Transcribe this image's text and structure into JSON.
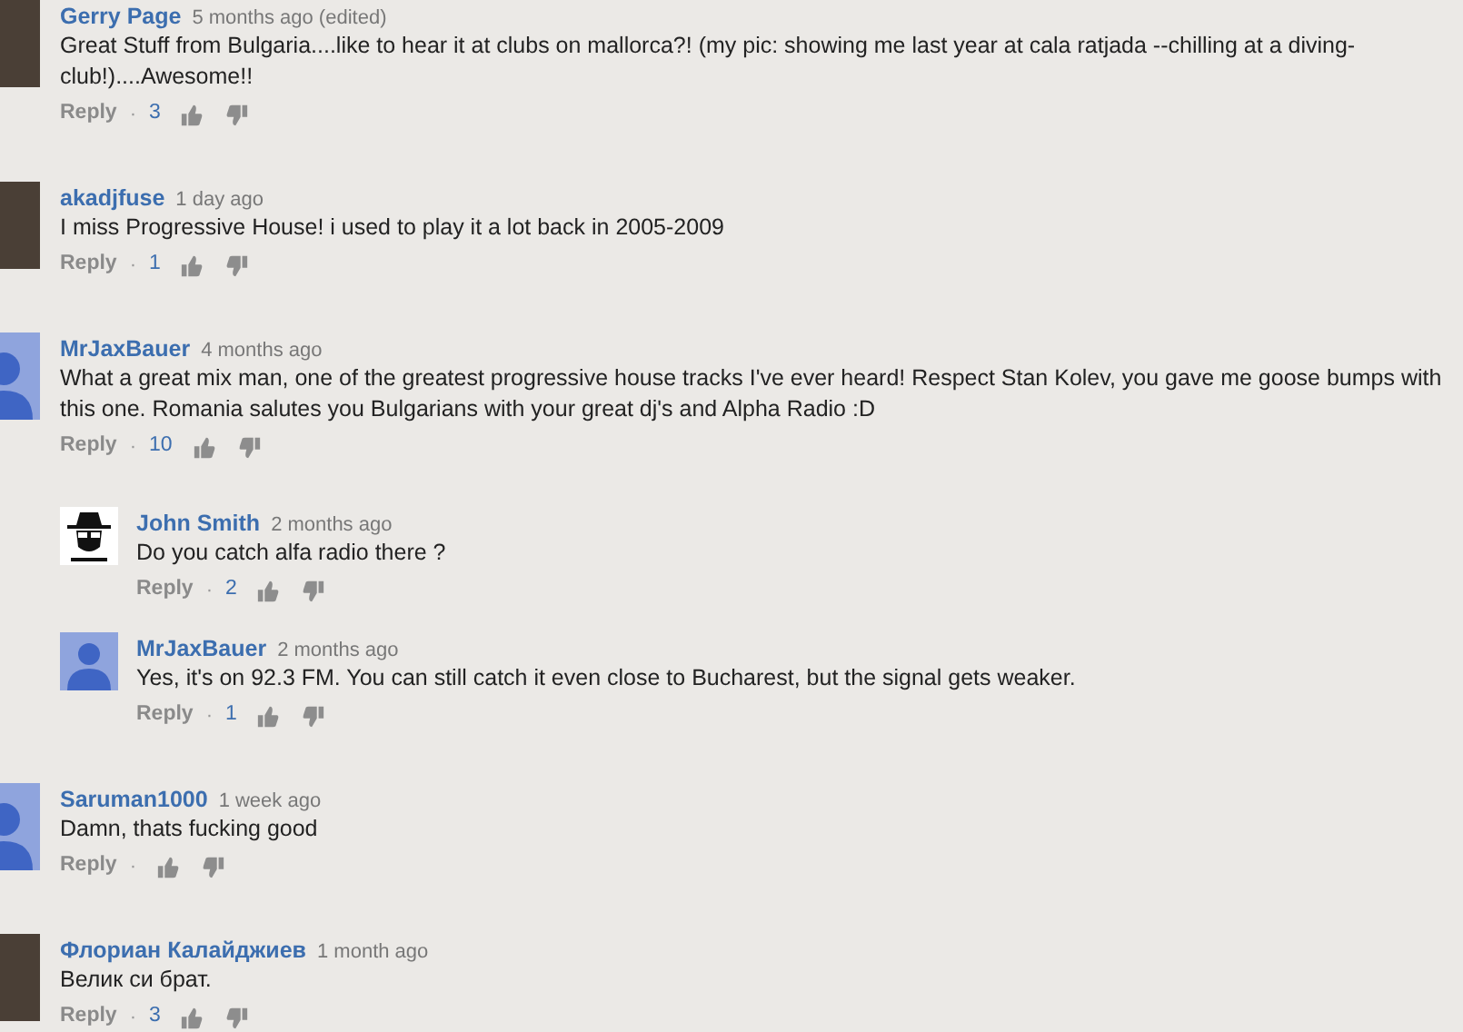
{
  "comments": [
    {
      "author": "Gerry Page",
      "time": "5 months ago (edited)",
      "text": "Great Stuff from Bulgaria....like to hear it at clubs on mallorca?!  (my pic: showing me last year at cala ratjada --chilling at a diving-club!)....Awesome!!",
      "kind": "photo",
      "reply": "Reply",
      "separator": "·",
      "likes": "3"
    },
    {
      "author": "akadjfuse",
      "time": "1 day ago",
      "text": "I miss Progressive House! i used to play it a lot back in 2005-2009",
      "kind": "photo",
      "reply": "Reply",
      "separator": "·",
      "likes": "1"
    },
    {
      "author": "MrJaxBauer",
      "time": "4 months ago",
      "text": "What a great mix man, one of the greatest progressive house tracks I've ever heard! Respect Stan Kolev, you gave me goose bumps with this one. Romania salutes you Bulgarians with your great dj's and Alpha Radio :D",
      "kind": "default",
      "reply": "Reply",
      "separator": "·",
      "likes": "10",
      "replies": [
        {
          "author": "John Smith",
          "time": "2 months ago",
          "text": "Do you catch alfa radio there ?",
          "kind": "hat",
          "reply": "Reply",
          "separator": "·",
          "likes": "2"
        },
        {
          "author": "MrJaxBauer",
          "time": "2 months ago",
          "text": "Yes, it's on 92.3 FM. You can still catch it even close to Bucharest, but the signal gets weaker.",
          "kind": "default",
          "reply": "Reply",
          "separator": "·",
          "likes": "1"
        }
      ]
    },
    {
      "author": "Saruman1000",
      "time": "1 week ago",
      "text": "Damn, thats fucking good",
      "kind": "default",
      "reply": "Reply",
      "separator": "·"
    },
    {
      "author": "Флориан Калайджиев",
      "time": "1 month ago",
      "text": "Велик си брат.",
      "kind": "photo",
      "reply": "Reply",
      "separator": "·",
      "likes": "3"
    }
  ]
}
